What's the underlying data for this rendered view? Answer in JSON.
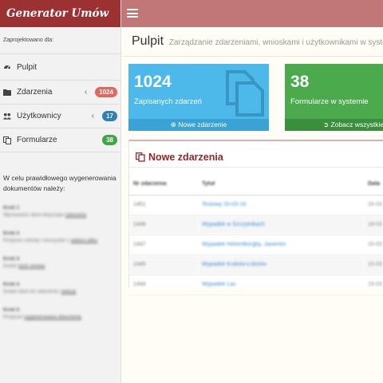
{
  "brand": "Generator Umów",
  "designed_by": "Zaprojektowano dla:",
  "colors": {
    "brand": "#9c3132",
    "topbar": "#c17778",
    "blue": "#4db8ea",
    "green": "#4baa4c"
  },
  "sidebar": {
    "items": [
      {
        "label": "Pulpit",
        "icon": "dashboard-icon",
        "badge": ""
      },
      {
        "label": "Zdarzenia",
        "icon": "folder-icon",
        "badge": "1024"
      },
      {
        "label": "Użytkownicy",
        "icon": "users-icon",
        "badge": "17"
      },
      {
        "label": "Formularze",
        "icon": "copy-icon",
        "badge": "38"
      }
    ],
    "intro": "W celu prawidłowego wygenerowania dokumentów należy:",
    "steps": [
      {
        "title": "Krok 1",
        "desc_pre": "Wprowadzić dane dotyczące ",
        "desc_link": "zdarzenia"
      },
      {
        "title": "Krok 2",
        "desc_pre": "Przejrzeć szkody i skorzystać z ",
        "desc_link": "wyboru pliku"
      },
      {
        "title": "Krok 3",
        "desc_pre": "Dodać ",
        "desc_link": "wzór umowy"
      },
      {
        "title": "Krok 4",
        "desc_pre": "Dodać dane do zdarzenia i ",
        "desc_link": "pobrać"
      },
      {
        "title": "Krok 5",
        "desc_pre": "Przejrzeć ",
        "desc_link": "wygenerowane dokumenty"
      }
    ]
  },
  "header": {
    "title": "Pulpit",
    "subtitle": "Zarządzanie zdarzeniami, wnioskami i użytkownikami w systemie"
  },
  "cards": {
    "events": {
      "count": "1024",
      "caption": "Zapisanych zdarzeń",
      "action": "Nowe zdarzenie"
    },
    "forms": {
      "count": "38",
      "caption": "Formularze w systemie",
      "action": "Zobacz wszystkie"
    }
  },
  "panel": {
    "title": "Nowe zdarzenia",
    "columns": [
      "Nr zdarzenia",
      "Tytuł",
      "Data"
    ],
    "rows": [
      {
        "num": "1451",
        "title": "Testowy 20-03-18",
        "date": "20-03"
      },
      {
        "num": "1449",
        "title": "Wypadek w Szczytnikach",
        "date": "18-03"
      },
      {
        "num": "1447",
        "title": "Wypadek Hohenlkorgby, Jasienko",
        "date": "16-03"
      },
      {
        "num": "1445",
        "title": "Wypadek Kraków-Łobzów",
        "date": "15-03"
      },
      {
        "num": "1444",
        "title": "Wypadek Las",
        "date": "15-03"
      }
    ]
  }
}
